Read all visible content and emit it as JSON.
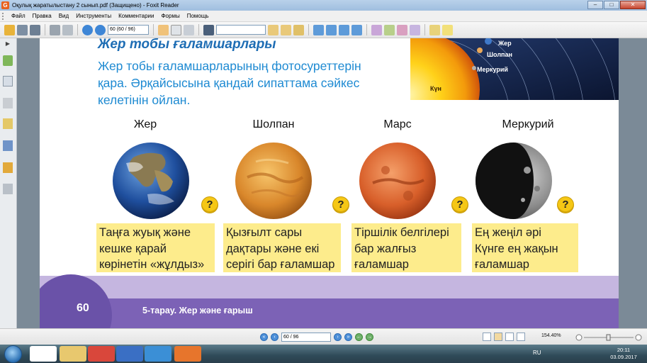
{
  "window": {
    "title": "Оқулық жаратылыстану 2 сынып.pdf (Защищено) - Foxit Reader",
    "logo_letter": "G"
  },
  "menu": [
    "Файл",
    "Правка",
    "Вид",
    "Инструменты",
    "Комментарии",
    "Формы",
    "Помощь"
  ],
  "toolbar": {
    "page_value": "60 (60 / 96)"
  },
  "page": {
    "section_title": "Жер тобы ғаламшарлары",
    "intro_lines": [
      "Жер тобы ғаламшарларының фотосуреттерін",
      "қара. Әрқайсысына қандай сипаттама сәйкес",
      "келетінін ойлан."
    ],
    "solar_labels": {
      "sun": "Күн",
      "earth": "Жер",
      "venus": "Шолпан",
      "mercury": "Меркурий"
    },
    "planets": [
      {
        "name": "Жер",
        "question": "?"
      },
      {
        "name": "Шолпан",
        "question": "?"
      },
      {
        "name": "Марс",
        "question": "?"
      },
      {
        "name": "Меркурий",
        "question": "?"
      }
    ],
    "cards": [
      {
        "lines": [
          "Таңға жуық және",
          "кешке қарай",
          "көрінетін «жұлдыз»"
        ]
      },
      {
        "lines": [
          "Қызғылт сары",
          "дақтары және екі",
          "серігі бар ғаламшар"
        ]
      },
      {
        "lines": [
          "Тіршілік белгілері",
          "бар жалғыз",
          "ғаламшар"
        ]
      },
      {
        "lines": [
          "Ең жеңіл әрі",
          "Күнге ең жақын",
          "ғаламшар"
        ]
      }
    ],
    "page_number": "60",
    "chapter": "5-тарау. Жер және ғарыш"
  },
  "statusbar": {
    "page_value": "60 / 96",
    "zoom": "154.40%"
  },
  "taskbar": {
    "lang": "RU",
    "time": "20:11",
    "date": "03.09.2017"
  },
  "colors": {
    "title_blue": "#1e6db4",
    "card_yellow": "#fdec8c",
    "footer_purple": "#7c62b6"
  }
}
